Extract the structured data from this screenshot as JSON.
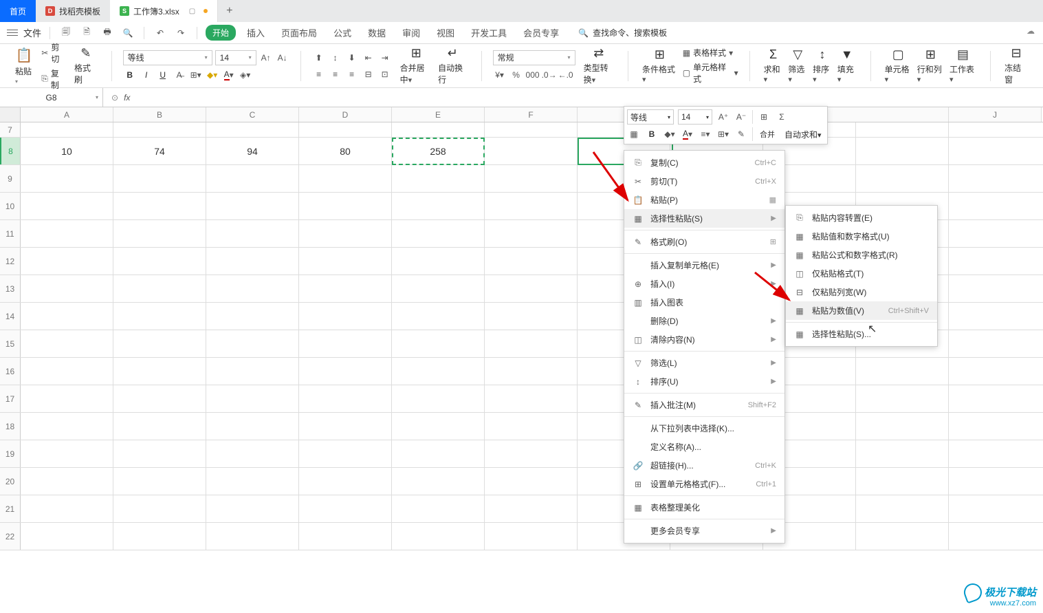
{
  "tabs": {
    "home": "首页",
    "find_templates": "找稻壳模板",
    "workbook": "工作簿3.xlsx"
  },
  "file_menu": "文件",
  "ribbon_tabs": [
    "开始",
    "插入",
    "页面布局",
    "公式",
    "数据",
    "审阅",
    "视图",
    "开发工具",
    "会员专享"
  ],
  "search_placeholder": "查找命令、搜索模板",
  "clipboard": {
    "paste": "粘贴",
    "cut": "剪切",
    "copy": "复制",
    "format_painter": "格式刷"
  },
  "font": {
    "name": "等线",
    "size": "14"
  },
  "align": {
    "merge": "合并居中",
    "wrap": "自动换行"
  },
  "number": {
    "general": "常规",
    "type_convert": "类型转换"
  },
  "styles": {
    "cond": "条件格式",
    "table_style": "表格样式",
    "cell_style": "单元格样式"
  },
  "editing": {
    "sum": "求和",
    "filter": "筛选",
    "sort": "排序",
    "fill": "填充"
  },
  "cells": {
    "cell": "单元格",
    "rowcol": "行和列",
    "sheet": "工作表",
    "freeze": "冻结窗"
  },
  "namebox": "G8",
  "columns": [
    "A",
    "B",
    "C",
    "D",
    "E",
    "F",
    "",
    "",
    "J"
  ],
  "rows": [
    "7",
    "8",
    "9",
    "10",
    "11",
    "12",
    "13",
    "14",
    "15",
    "16",
    "17",
    "18",
    "19",
    "20",
    "21",
    "22"
  ],
  "data_row8": {
    "A": "10",
    "B": "74",
    "C": "94",
    "D": "80",
    "E": "258"
  },
  "mini_toolbar": {
    "font": "等线",
    "size": "14",
    "merge": "合并",
    "autosum": "自动求和"
  },
  "context_menu": [
    {
      "icon": "⎘",
      "label": "复制(C)",
      "shortcut": "Ctrl+C"
    },
    {
      "icon": "✂",
      "label": "剪切(T)",
      "shortcut": "Ctrl+X"
    },
    {
      "icon": "📋",
      "label": "粘贴(P)",
      "right_icon": "▦"
    },
    {
      "icon": "▦",
      "label": "选择性粘贴(S)",
      "arrow": true,
      "highlighted": true
    },
    {
      "sep": true
    },
    {
      "icon": "✎",
      "label": "格式刷(O)",
      "right_icon": "⊞"
    },
    {
      "sep": true
    },
    {
      "label": "插入复制单元格(E)",
      "arrow": true
    },
    {
      "icon": "⊕",
      "label": "插入(I)",
      "arrow": true
    },
    {
      "icon": "▥",
      "label": "插入图表",
      "disabled": true
    },
    {
      "label": "删除(D)",
      "arrow": true
    },
    {
      "icon": "◫",
      "label": "清除内容(N)",
      "arrow": true
    },
    {
      "sep": true
    },
    {
      "icon": "▽",
      "label": "筛选(L)",
      "arrow": true
    },
    {
      "icon": "↕",
      "label": "排序(U)",
      "arrow": true
    },
    {
      "sep": true
    },
    {
      "icon": "✎",
      "label": "插入批注(M)",
      "shortcut": "Shift+F2"
    },
    {
      "sep": true
    },
    {
      "label": "从下拉列表中选择(K)..."
    },
    {
      "label": "定义名称(A)..."
    },
    {
      "icon": "🔗",
      "label": "超链接(H)...",
      "shortcut": "Ctrl+K"
    },
    {
      "icon": "⊞",
      "label": "设置单元格格式(F)...",
      "shortcut": "Ctrl+1"
    },
    {
      "sep": true
    },
    {
      "icon": "▦",
      "label": "表格整理美化"
    },
    {
      "sep": true
    },
    {
      "label": "更多会员专享",
      "arrow": true
    }
  ],
  "submenu": [
    {
      "icon": "⎘",
      "label": "粘贴内容转置(E)"
    },
    {
      "icon": "▦",
      "label": "粘贴值和数字格式(U)"
    },
    {
      "icon": "▦",
      "label": "粘贴公式和数字格式(R)"
    },
    {
      "icon": "◫",
      "label": "仅粘贴格式(T)"
    },
    {
      "icon": "⊟",
      "label": "仅粘贴列宽(W)"
    },
    {
      "icon": "▦",
      "label": "粘贴为数值(V)",
      "shortcut": "Ctrl+Shift+V",
      "highlighted": true
    },
    {
      "sep": true
    },
    {
      "icon": "▦",
      "label": "选择性粘贴(S)..."
    }
  ],
  "watermark": {
    "l1": "极光下载站",
    "l2": "www.xz7.com"
  }
}
